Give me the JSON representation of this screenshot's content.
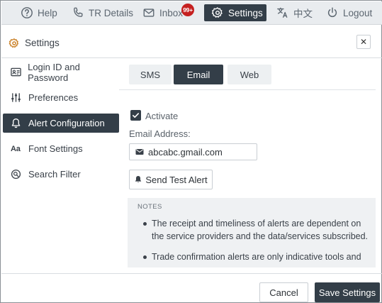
{
  "nav": {
    "help": "Help",
    "tr_details": "TR Details",
    "inbox": "Inbox",
    "inbox_badge": "99+",
    "settings": "Settings",
    "language": "中文",
    "logout": "Logout"
  },
  "dialog": {
    "title": "Settings",
    "close_glyph": "✕"
  },
  "sidebar": {
    "items": [
      {
        "label": "Login ID and Password",
        "icon": "id-card-icon"
      },
      {
        "label": "Preferences",
        "icon": "sliders-icon"
      },
      {
        "label": "Alert Configuration",
        "icon": "bell-icon",
        "active": true
      },
      {
        "label": "Font Settings",
        "icon": "font-icon",
        "icon_text": "Aa"
      },
      {
        "label": "Search Filter",
        "icon": "search-icon"
      }
    ]
  },
  "tabs": [
    {
      "label": "SMS"
    },
    {
      "label": "Email",
      "active": true
    },
    {
      "label": "Web"
    }
  ],
  "email_form": {
    "activate_label": "Activate",
    "activate_checked": true,
    "email_label": "Email Address:",
    "email_value": "abcabc.gmail.com",
    "test_button": "Send Test Alert"
  },
  "notes": {
    "title": "NOTES",
    "items": [
      "The receipt and timeliness of alerts are dependent on the service providers and the data/services subscribed.",
      "Trade confirmation alerts are only indicative tools and are"
    ]
  },
  "footer": {
    "cancel": "Cancel",
    "save": "Save Settings"
  },
  "colors": {
    "dark_accent": "#333e48",
    "badge_red": "#c52020"
  }
}
